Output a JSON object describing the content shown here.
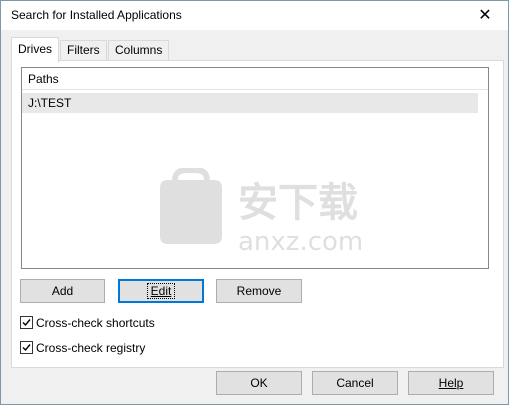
{
  "window": {
    "title": "Search for Installed Applications",
    "close_glyph": "✕"
  },
  "tabs": [
    {
      "label": "Drives",
      "active": true
    },
    {
      "label": "Filters",
      "active": false
    },
    {
      "label": "Columns",
      "active": false
    }
  ],
  "paths_list": {
    "header": "Paths",
    "rows": [
      "J:\\TEST"
    ]
  },
  "buttons": {
    "add": "Add",
    "edit": "Edit",
    "remove": "Remove"
  },
  "options": {
    "cross_check_shortcuts": {
      "label": "Cross-check shortcuts",
      "checked": true
    },
    "cross_check_registry": {
      "label": "Cross-check registry",
      "checked": true
    }
  },
  "dialog_buttons": {
    "ok": "OK",
    "cancel": "Cancel",
    "help": "Help"
  },
  "watermark": {
    "text_cn": "安下载",
    "text_domain": "anxz.com"
  }
}
